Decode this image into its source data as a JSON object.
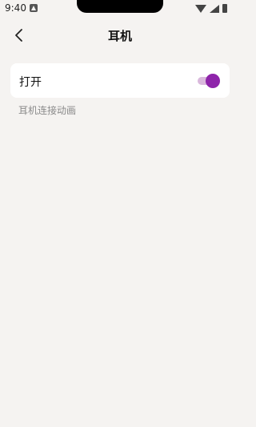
{
  "status_bar": {
    "time": "9:40"
  },
  "header": {
    "title": "耳机"
  },
  "setting": {
    "label": "打开",
    "enabled": true,
    "caption": "耳机连接动画"
  },
  "colors": {
    "toggle_thumb": "#8e24aa",
    "toggle_track": "#d9b8dc",
    "background": "#f5f3f1"
  }
}
